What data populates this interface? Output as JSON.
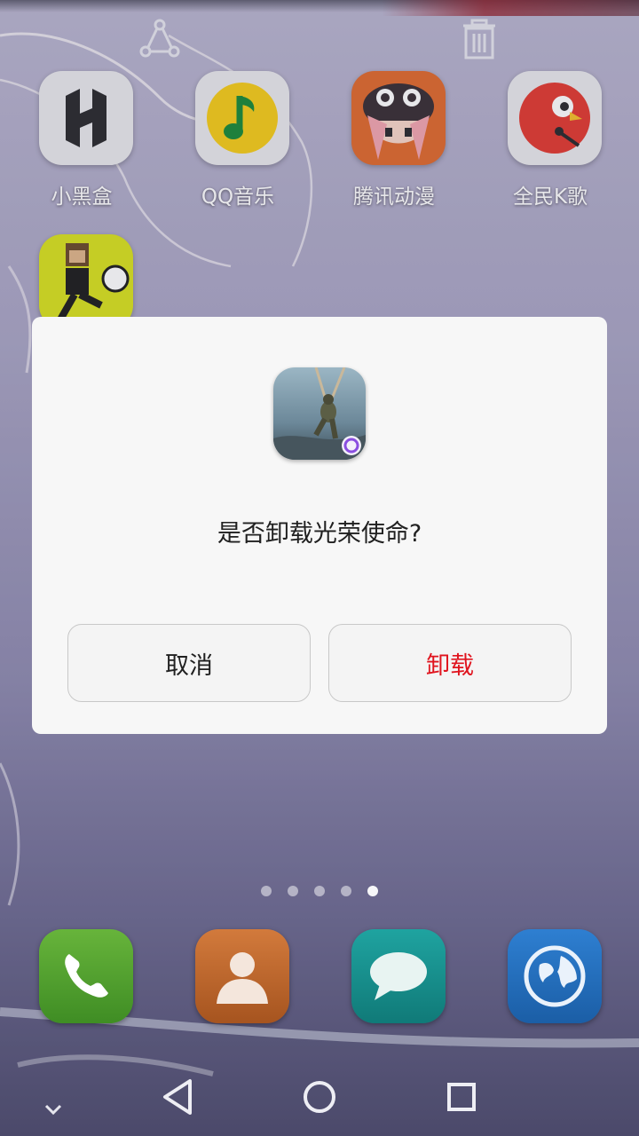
{
  "launcher": {
    "top_actions": {
      "share_icon": "share-icon",
      "trash_icon": "trash-icon"
    },
    "apps": [
      {
        "label": "小黑盒",
        "icon": "heybox-icon"
      },
      {
        "label": "QQ音乐",
        "icon": "qqmusic-icon"
      },
      {
        "label": "腾讯动漫",
        "icon": "tencent-comic-icon"
      },
      {
        "label": "全民K歌",
        "icon": "kge-icon"
      }
    ],
    "partial_app_icon": "soccer-game-icon",
    "page_indicator": {
      "total": 5,
      "active_index": 4
    },
    "dock": [
      "phone-icon",
      "contacts-icon",
      "messages-icon",
      "browser-icon"
    ]
  },
  "dialog": {
    "app_icon": "call-of-duty-icon",
    "question": "是否卸载光荣使命?",
    "cancel_label": "取消",
    "uninstall_label": "卸载",
    "uninstall_color": "#e0141e"
  },
  "navigation": [
    "collapse-icon",
    "back-icon",
    "home-icon",
    "recents-icon"
  ]
}
